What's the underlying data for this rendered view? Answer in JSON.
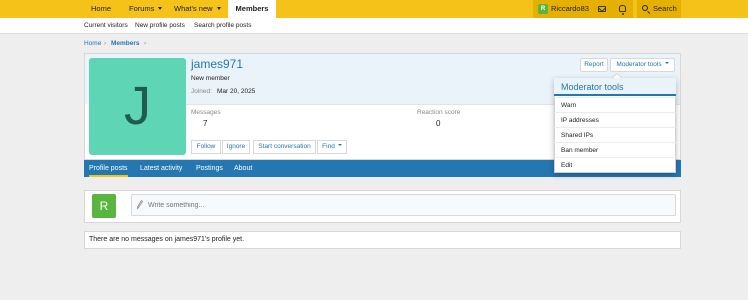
{
  "colors": {
    "nav_bg": "#f5c21a",
    "accent": "#2577b1",
    "avatar_j": "#5ed6b6",
    "avatar_r": "#58b53f"
  },
  "topnav": {
    "home": "Home",
    "forums": "Forums",
    "whats_new": "What's new",
    "members": "Members",
    "username": "Riccardo83",
    "user_initial": "R",
    "search": "Search",
    "icons": [
      "envelope-icon",
      "bell-icon",
      "search-icon"
    ]
  },
  "subnav": [
    "Current visitors",
    "New profile posts",
    "Search profile posts"
  ],
  "breadcrumb": {
    "home": "Home",
    "members": "Members"
  },
  "profile": {
    "avatar_letter": "J",
    "username": "james971",
    "role": "New member",
    "joined_label": "Joined:",
    "joined_value": "Mar 20, 2025",
    "messages_label": "Messages",
    "messages_value": "7",
    "reaction_label": "Reaction score",
    "reaction_value": "0",
    "report": "Report",
    "moderator_tools": "Moderator tools",
    "actions": [
      "Follow",
      "Ignore",
      "Start conversation",
      "Find"
    ]
  },
  "tabs": [
    "Profile posts",
    "Latest activity",
    "Postings",
    "About"
  ],
  "post": {
    "user_initial": "R",
    "placeholder": "Write something..."
  },
  "empty_message": "There are no messages on james971's profile yet.",
  "moderator_menu": {
    "title": "Moderator tools",
    "items": [
      "Warn",
      "IP addresses",
      "Shared IPs",
      "Ban member",
      "Edit"
    ]
  }
}
